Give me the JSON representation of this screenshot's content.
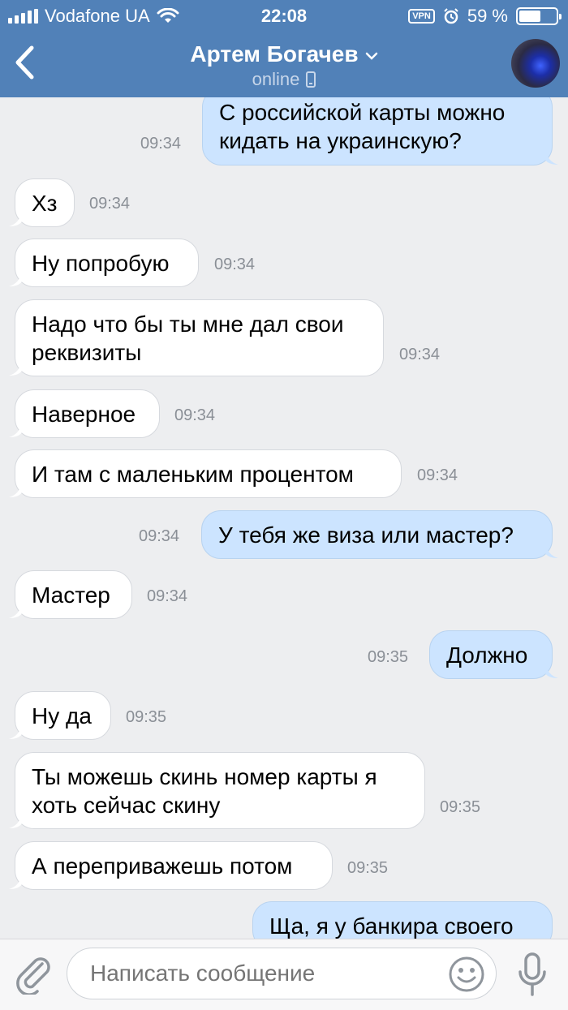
{
  "status_bar": {
    "carrier": "Vodafone UA",
    "time": "22:08",
    "vpn_label": "VPN",
    "battery_percent": "59 %",
    "battery_level": 0.59
  },
  "header": {
    "contact_name": "Артем Богачев",
    "presence": "online"
  },
  "messages": [
    {
      "dir": "out",
      "text": "С российской карты можно кидать на украинскую?",
      "time": "09:34"
    },
    {
      "dir": "in",
      "text": "Хз",
      "time": "09:34"
    },
    {
      "dir": "in",
      "text": "Ну попробую",
      "time": "09:34"
    },
    {
      "dir": "in",
      "text": "Надо что бы ты мне дал свои реквизиты",
      "time": "09:34"
    },
    {
      "dir": "in",
      "text": "Наверное",
      "time": "09:34"
    },
    {
      "dir": "in",
      "text": "И там с маленьким процентом",
      "time": "09:34"
    },
    {
      "dir": "out",
      "text": "У тебя же виза или мастер?",
      "time": "09:34"
    },
    {
      "dir": "in",
      "text": "Мастер",
      "time": "09:34"
    },
    {
      "dir": "out",
      "text": "Должно",
      "time": "09:35"
    },
    {
      "dir": "in",
      "text": "Ну да",
      "time": "09:35"
    },
    {
      "dir": "in",
      "text": "Ты можешь скинь номер карты я хоть сейчас скину",
      "time": "09:35"
    },
    {
      "dir": "in",
      "text": "А переприважешь потом",
      "time": "09:35"
    },
    {
      "dir": "out",
      "text": "Ща, я у банкира своего",
      "time": ""
    }
  ],
  "composer": {
    "placeholder": "Написать сообщение"
  },
  "colors": {
    "header": "#5181b8",
    "incoming_bubble": "#ffffff",
    "outgoing_bubble": "#cce4ff",
    "background": "#edeef0"
  }
}
